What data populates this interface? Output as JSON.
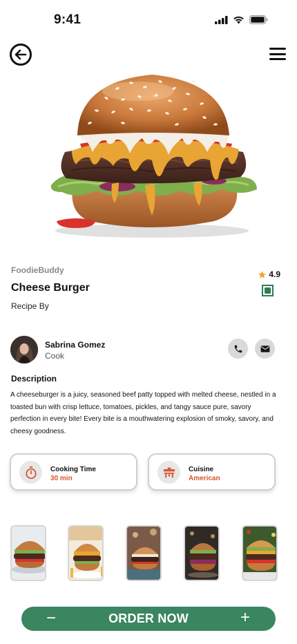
{
  "status_bar": {
    "time": "9:41"
  },
  "nav": {
    "back_icon": "arrow-left-circle-icon",
    "menu_icon": "hamburger-menu-icon"
  },
  "hero": {
    "image": "cheeseburger-photo"
  },
  "recipe": {
    "brand": "FoodieBuddy",
    "title": "Cheese Burger",
    "recipe_by": "Recipe By",
    "rating": "4.9",
    "rating_color": "#f4a12b",
    "veg_badge_color": "#2e7d4f"
  },
  "author": {
    "name": "Sabrina Gomez",
    "role": "Cook",
    "call_icon": "phone-icon",
    "mail_icon": "mail-icon"
  },
  "description": {
    "heading": "Description",
    "text": "A cheeseburger is a juicy, seasoned beef patty topped with melted cheese, nestled in a toasted bun with crisp lettuce, tomatoes, pickles, and tangy sauce pure, savory perfection in every bite! Every bite is a mouthwatering explosion of smoky, savory, and cheesy goodness."
  },
  "info_cards": [
    {
      "label": "Cooking Time",
      "value": "30 min",
      "icon": "stopwatch-icon"
    },
    {
      "label": "Cuisine",
      "value": "American",
      "icon": "serving-dish-icon"
    }
  ],
  "accent_color": "#d8552f",
  "thumbnails": [
    {
      "name": "burger-thumb-1"
    },
    {
      "name": "burger-thumb-2"
    },
    {
      "name": "burger-thumb-3"
    },
    {
      "name": "burger-thumb-4"
    },
    {
      "name": "burger-thumb-5"
    }
  ],
  "order": {
    "label": "ORDER NOW",
    "minus": "−",
    "plus": "+",
    "color": "#3a8660"
  }
}
